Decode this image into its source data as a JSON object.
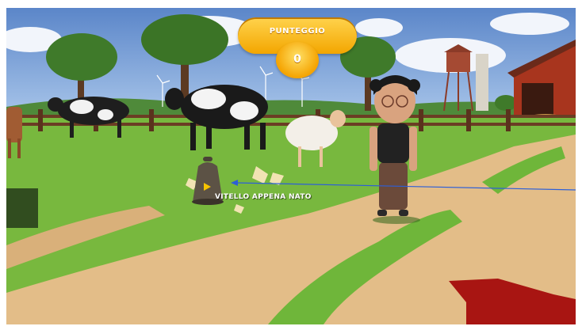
{
  "hud": {
    "score_label": "PUNTEGGIO",
    "score_value": "0"
  },
  "target": {
    "label": "VITELLO APPENA NATO"
  },
  "colors": {
    "sky": "#6f9bd6",
    "grass": "#77b93d",
    "path": "#e2bb86",
    "fence": "#6b3d24",
    "hud_yellow": "#f8c11c",
    "pointer_line": "#2d5fd8",
    "arrow_red": "#a81512"
  },
  "icons": [
    "bell-icon",
    "pointer-arrow-icon",
    "direction-arrow-icon"
  ]
}
